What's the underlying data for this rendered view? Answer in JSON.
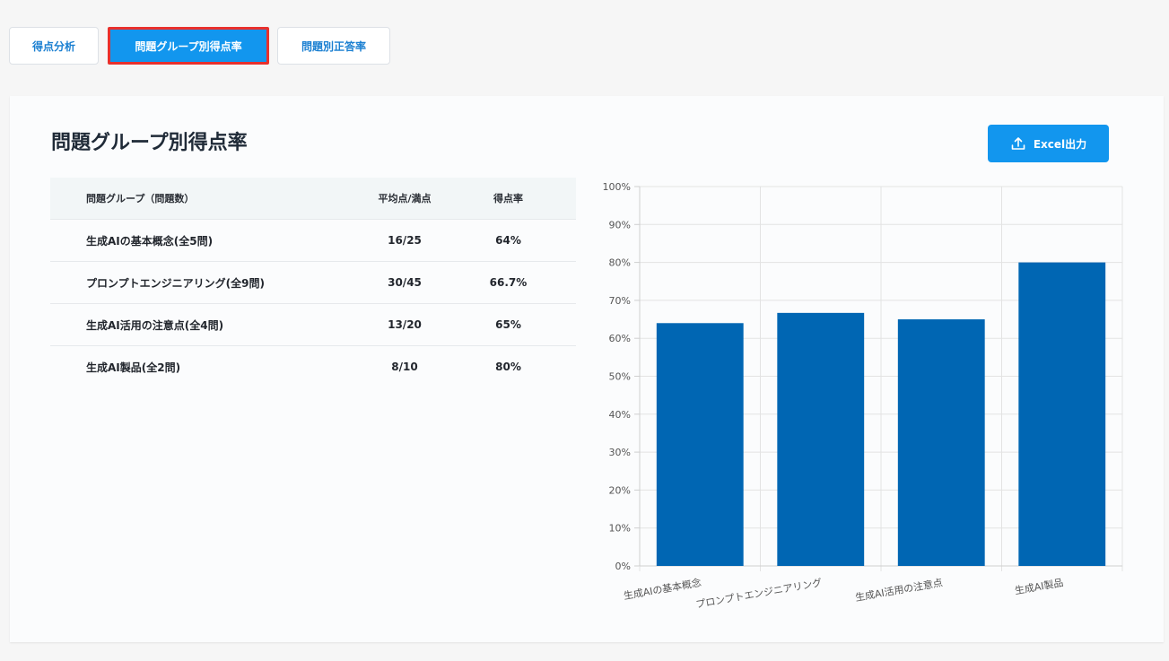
{
  "tabs": [
    {
      "label": "得点分析",
      "active": false
    },
    {
      "label": "問題グループ別得点率",
      "active": true
    },
    {
      "label": "問題別正答率",
      "active": false
    }
  ],
  "page_title": "問題グループ別得点率",
  "excel_button": {
    "label": "Excel出力",
    "icon": "upload-icon"
  },
  "table": {
    "headers": [
      "問題グループ（問題数）",
      "平均点/満点",
      "得点率"
    ],
    "rows": [
      {
        "group": "生成AIの基本概念(全5問)",
        "score": "16/25",
        "rate": "64%"
      },
      {
        "group": "プロンプトエンジニアリング(全9問)",
        "score": "30/45",
        "rate": "66.7%"
      },
      {
        "group": "生成AI活用の注意点(全4問)",
        "score": "13/20",
        "rate": "65%"
      },
      {
        "group": "生成AI製品(全2問)",
        "score": "8/10",
        "rate": "80%"
      }
    ]
  },
  "colors": {
    "accent": "#1296ee",
    "bar": "#0066b3",
    "highlight_border": "#e8302c"
  },
  "chart_data": {
    "type": "bar",
    "categories": [
      "生成AIの基本概念",
      "プロンプトエンジニアリング",
      "生成AI活用の注意点",
      "生成AI製品"
    ],
    "values": [
      64,
      66.7,
      65,
      80
    ],
    "ylim": [
      0,
      100
    ],
    "yticks": [
      0,
      10,
      20,
      30,
      40,
      50,
      60,
      70,
      80,
      90,
      100
    ],
    "ytick_labels": [
      "0%",
      "10%",
      "20%",
      "30%",
      "40%",
      "50%",
      "60%",
      "70%",
      "80%",
      "90%",
      "100%"
    ],
    "grid": true,
    "title": "",
    "xlabel": "",
    "ylabel": ""
  }
}
